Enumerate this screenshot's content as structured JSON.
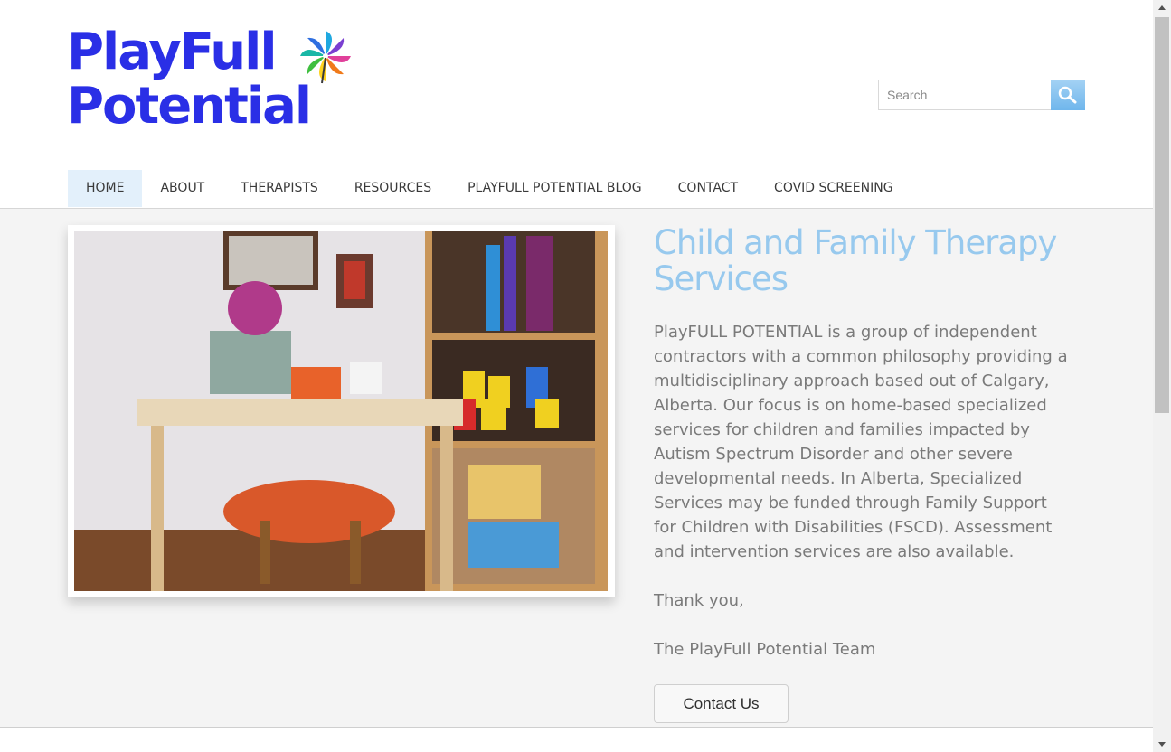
{
  "logo": {
    "line1": "PlayFull",
    "line2": "Potential",
    "icon": "pinwheel-icon"
  },
  "search": {
    "placeholder": "Search",
    "value": "",
    "icon": "magnifier-icon"
  },
  "nav": {
    "items": [
      {
        "label": "HOME",
        "active": true
      },
      {
        "label": "ABOUT"
      },
      {
        "label": "THERAPISTS"
      },
      {
        "label": "RESOURCES"
      },
      {
        "label": "PLAYFULL POTENTIAL BLOG"
      },
      {
        "label": "CONTACT"
      },
      {
        "label": "COVID SCREENING"
      }
    ]
  },
  "main": {
    "title": "Child and Family Therapy Services",
    "paragraph": "PlayFULL POTENTIAL is a group of independent contractors with a common philosophy providing a multidisciplinary approach based out of Calgary, Alberta. Our focus is on home-based specialized services for children and families impacted by Autism Spectrum Disorder and other severe developmental needs. In Alberta, Specialized Services may be funded through Family Support for Children with Disabilities (FSCD). Assessment and intervention services are also available.",
    "thanks": "Thank you,",
    "signoff": "The PlayFull Potential Team",
    "button": "Contact Us"
  },
  "colors": {
    "brand": "#2a2fe6",
    "accent": "#97c9ee",
    "nav_active_bg": "#e3f0fb"
  }
}
